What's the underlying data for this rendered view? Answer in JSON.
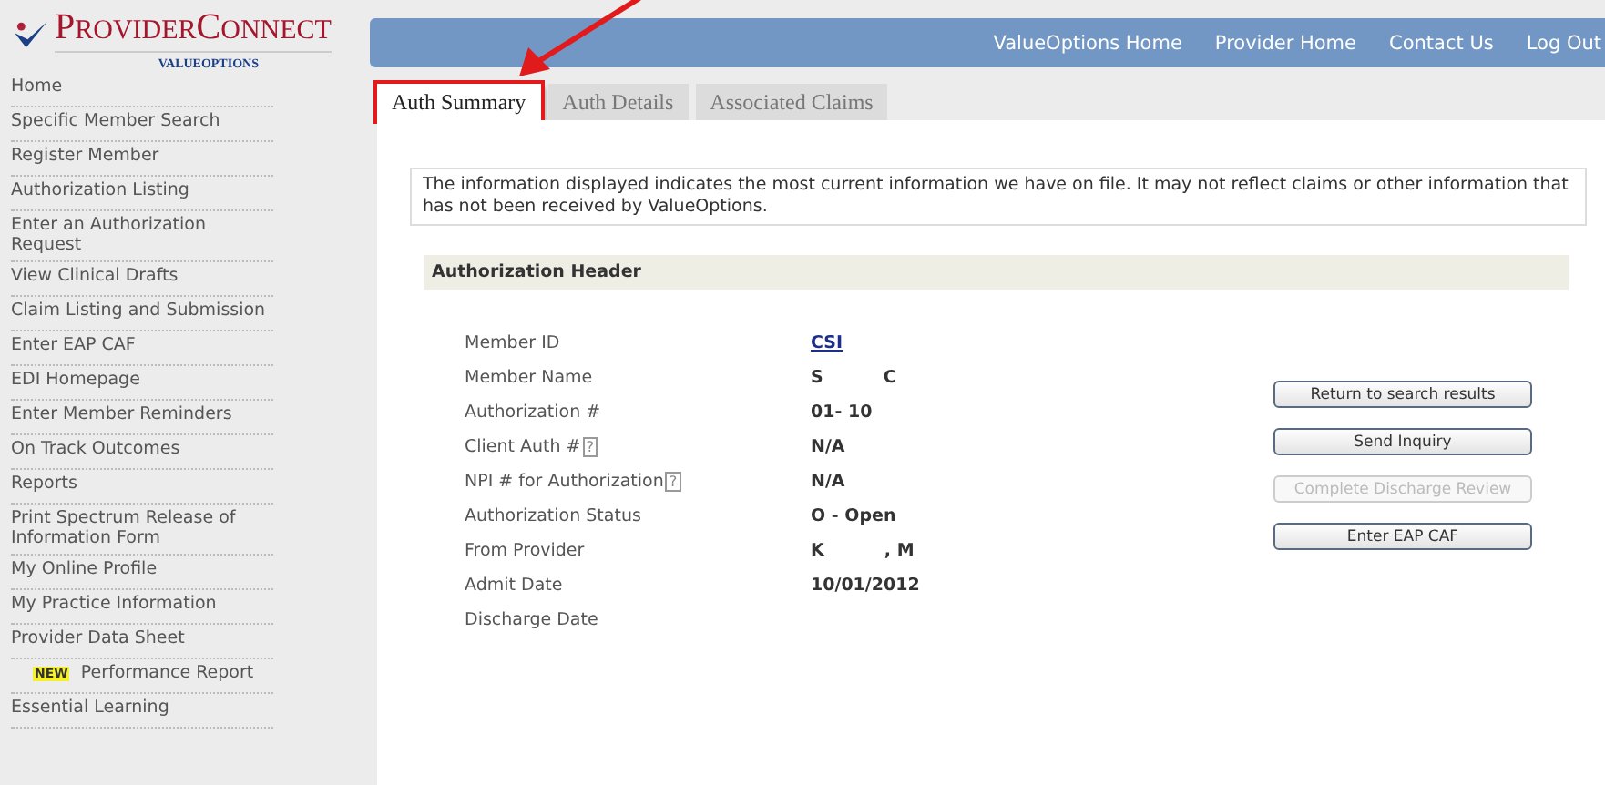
{
  "logo": {
    "title_initial": "P",
    "title_rest": "ROVIDER",
    "title_initial2": "C",
    "title_rest2": "ONNECT",
    "subtitle": "VALUEOPTIONS"
  },
  "top_nav": [
    "ValueOptions Home",
    "Provider Home",
    "Contact Us",
    "Log Out"
  ],
  "sidebar": {
    "items": [
      {
        "label": "Home"
      },
      {
        "label": "Specific Member Search"
      },
      {
        "label": "Register Member"
      },
      {
        "label": "Authorization Listing"
      },
      {
        "label": "Enter an Authorization Request"
      },
      {
        "label": "View Clinical Drafts"
      },
      {
        "label": "Claim Listing and Submission"
      },
      {
        "label": "Enter EAP CAF"
      },
      {
        "label": "EDI Homepage"
      },
      {
        "label": "Enter Member Reminders"
      },
      {
        "label": "On Track Outcomes"
      },
      {
        "label": "Reports"
      },
      {
        "label": "Print Spectrum Release of Information Form"
      },
      {
        "label": "My Online Profile"
      },
      {
        "label": "My Practice Information"
      },
      {
        "label": "Provider Data Sheet"
      },
      {
        "label": "Performance Report",
        "badge": "NEW"
      },
      {
        "label": "Essential Learning"
      }
    ]
  },
  "tabs": [
    {
      "label": "Auth Summary",
      "selected": true
    },
    {
      "label": "Auth Details",
      "selected": false
    },
    {
      "label": "Associated Claims",
      "selected": false
    }
  ],
  "notice": "The information displayed indicates the most current information we have on file. It may not reflect claims or other information that has not been received by ValueOptions.",
  "section_title": "Authorization Header",
  "fields": [
    {
      "label": "Member ID",
      "value": "CSI",
      "kind": "link"
    },
    {
      "label": "Member Name",
      "value": "S          C",
      "kind": "text"
    },
    {
      "label": "Authorization #",
      "value": "01- 10",
      "kind": "text"
    },
    {
      "label": "Client Auth #",
      "help": "?",
      "value": "N/A",
      "kind": "text"
    },
    {
      "label": "NPI # for Authorization",
      "help": "?",
      "value": "N/A",
      "kind": "text"
    },
    {
      "label": "Authorization Status",
      "value": "O - Open",
      "kind": "text"
    },
    {
      "label": "From Provider",
      "value": "K          , M",
      "kind": "text"
    },
    {
      "label": "Admit Date",
      "value": "10/01/2012",
      "kind": "text"
    },
    {
      "label": "Discharge Date",
      "kind": "text"
    }
  ],
  "buttons": [
    {
      "label": "Return to search results",
      "disabled": false
    },
    {
      "label": "Send Inquiry",
      "disabled": false
    },
    {
      "label": "Complete Discharge Review",
      "disabled": true
    },
    {
      "label": "Enter EAP CAF",
      "disabled": false
    }
  ]
}
